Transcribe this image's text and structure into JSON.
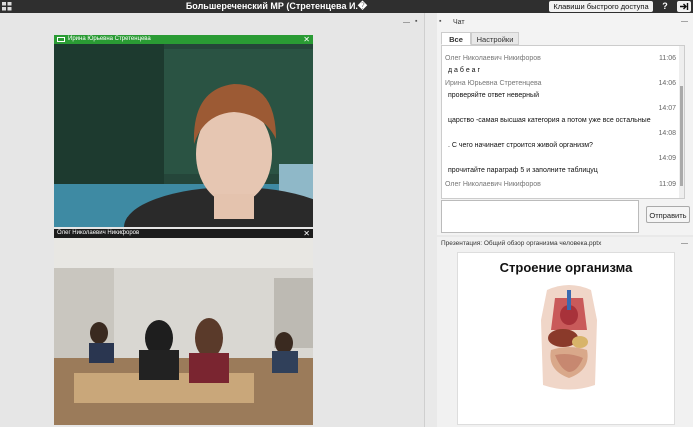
{
  "topbar": {
    "title": "Большереченский МР (Стретенцева И.�",
    "shortcuts_label": "Клавиши быстрого доступа",
    "help_label": "?"
  },
  "videos": [
    {
      "name": "Ирина Юрьевна Стретенцева"
    },
    {
      "name": "Олег Николаевич Никифоров"
    }
  ],
  "chat": {
    "title": "Чат",
    "tabs": [
      "Все",
      "Настройки"
    ],
    "messages": [
      {
        "sender": "Олег Николаевич Никифоров",
        "time": "11:06",
        "text": "д а б е а г"
      },
      {
        "sender": "Ирина Юрьевна Стретенцева",
        "time": "14:06",
        "text": "проверяйте ответ неверный"
      },
      {
        "sender": "",
        "time": "14:07",
        "text": "царство -самая высшая категория а потом уже все  остальные"
      },
      {
        "sender": "",
        "time": "14:08",
        "text": ". С чего начинает строится живой организм?"
      },
      {
        "sender": "",
        "time": "14:09",
        "text": "прочитайте параграф 5 и заполните таблицуц"
      },
      {
        "sender": "Олег Николаевич Никифоров",
        "time": "11:09",
        "text": ""
      }
    ],
    "input_value": "",
    "send_label": "Отправить"
  },
  "presentation": {
    "title": "Презентация: Общий обзор организма человека.pptx",
    "slide_title": "Строение организма"
  },
  "colors": {
    "topbar_bg": "#2f2f2f",
    "active_video_header": "#2a9b34"
  }
}
